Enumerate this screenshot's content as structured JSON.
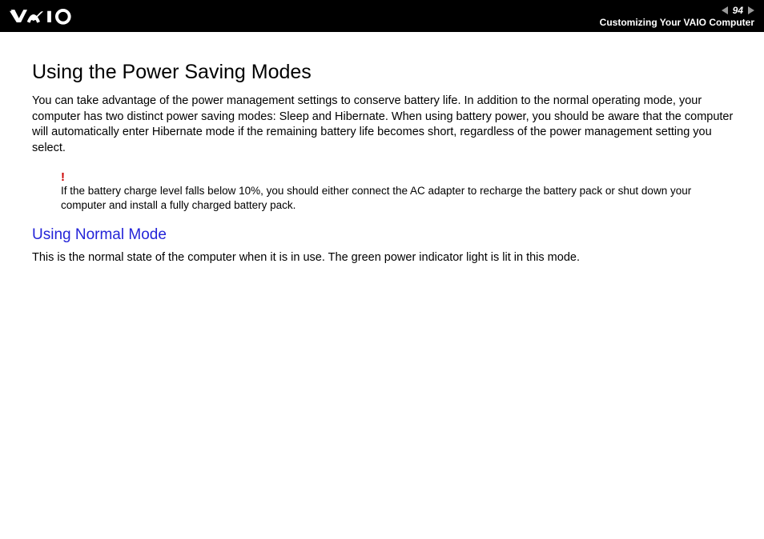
{
  "header": {
    "page_number": "94",
    "section_title": "Customizing Your VAIO Computer"
  },
  "content": {
    "main_heading": "Using the Power Saving Modes",
    "intro_text": "You can take advantage of the power management settings to conserve battery life. In addition to the normal operating mode, your computer has two distinct power saving modes: Sleep and Hibernate. When using battery power, you should be aware that the computer will automatically enter Hibernate mode if the remaining battery life becomes short, regardless of the power management setting you select.",
    "warning_mark": "!",
    "warning_text": "If the battery charge level falls below 10%, you should either connect the AC adapter to recharge the battery pack or shut down your computer and install a fully charged battery pack.",
    "sub_heading": "Using Normal Mode",
    "sub_text": "This is the normal state of the computer when it is in use. The green power indicator light is lit in this mode."
  }
}
